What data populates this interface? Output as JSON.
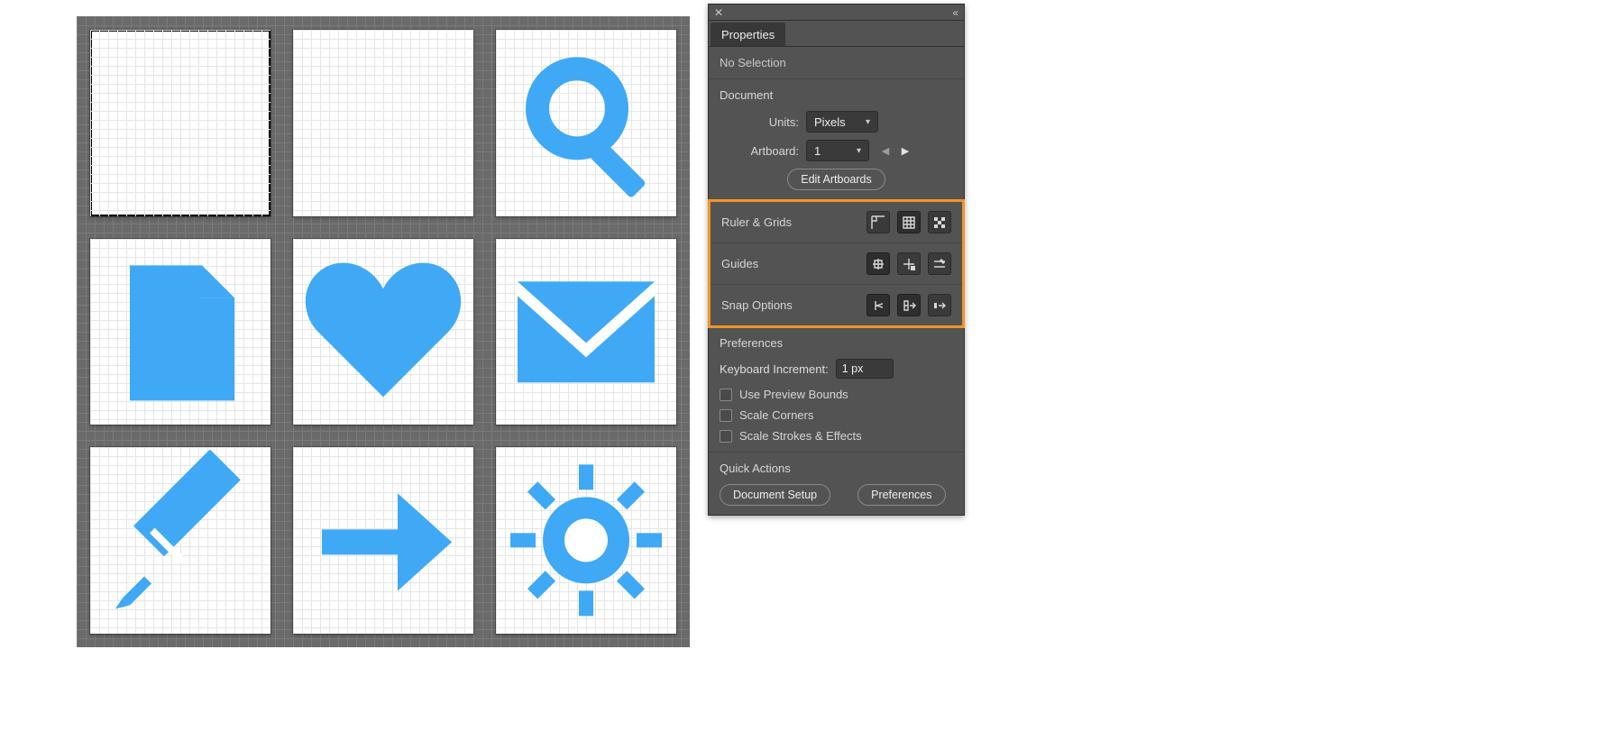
{
  "panel": {
    "tab": "Properties",
    "selection_status": "No Selection",
    "document": {
      "heading": "Document",
      "units_label": "Units:",
      "units_value": "Pixels",
      "artboard_label": "Artboard:",
      "artboard_value": "1",
      "edit_artboards": "Edit Artboards"
    },
    "options": {
      "ruler_grids": "Ruler & Grids",
      "guides": "Guides",
      "snap": "Snap Options"
    },
    "prefs": {
      "heading": "Preferences",
      "kb_inc_label": "Keyboard Increment:",
      "kb_inc_value": "1 px",
      "use_preview_bounds": "Use Preview Bounds",
      "scale_corners": "Scale Corners",
      "scale_strokes": "Scale Strokes & Effects"
    },
    "quick_actions": {
      "heading": "Quick Actions",
      "document_setup": "Document Setup",
      "preferences": "Preferences"
    }
  },
  "artboards": [
    {
      "name": "artboard-1-blank",
      "selected": true,
      "icon": "blank"
    },
    {
      "name": "artboard-2-blank",
      "selected": false,
      "icon": "blank"
    },
    {
      "name": "artboard-3-search",
      "selected": false,
      "icon": "search"
    },
    {
      "name": "artboard-4-file",
      "selected": false,
      "icon": "file"
    },
    {
      "name": "artboard-5-heart",
      "selected": false,
      "icon": "heart"
    },
    {
      "name": "artboard-6-mail",
      "selected": false,
      "icon": "mail"
    },
    {
      "name": "artboard-7-pencil",
      "selected": false,
      "icon": "pencil"
    },
    {
      "name": "artboard-8-arrow",
      "selected": false,
      "icon": "arrow"
    },
    {
      "name": "artboard-9-gear",
      "selected": false,
      "icon": "gear"
    }
  ],
  "colors": {
    "icon_blue": "#3fa9f5",
    "highlight_orange": "#f29427"
  }
}
